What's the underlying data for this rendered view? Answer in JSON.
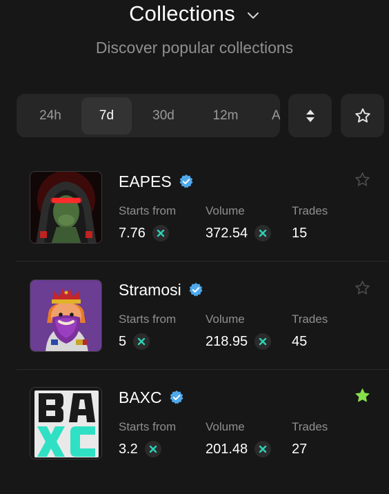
{
  "header": {
    "title": "Collections",
    "subtitle": "Discover popular collections"
  },
  "filters": {
    "tabs": [
      {
        "label": "24h",
        "active": false
      },
      {
        "label": "7d",
        "active": true
      },
      {
        "label": "30d",
        "active": false
      },
      {
        "label": "12m",
        "active": false
      },
      {
        "label": "A",
        "active": false
      }
    ],
    "sort_icon": "sort-up-down-icon",
    "favorite_icon": "star-outline-icon"
  },
  "labels": {
    "starts_from": "Starts from",
    "volume": "Volume",
    "trades": "Trades"
  },
  "collections": [
    {
      "name": "EAPES",
      "verified": true,
      "starts_from": "7.76",
      "volume": "372.54",
      "trades": "15",
      "favorited": false
    },
    {
      "name": "Stramosi",
      "verified": true,
      "starts_from": "5",
      "volume": "218.95",
      "trades": "45",
      "favorited": false
    },
    {
      "name": "BAXC",
      "verified": true,
      "starts_from": "3.2",
      "volume": "201.48",
      "trades": "27",
      "favorited": true
    }
  ],
  "colors": {
    "background": "#171717",
    "panel": "#262626",
    "verified": "#4ea8ec",
    "favorite_active": "#86e04a",
    "coin_accent": "#2ed3b7",
    "muted_text": "#8f8f8f"
  }
}
